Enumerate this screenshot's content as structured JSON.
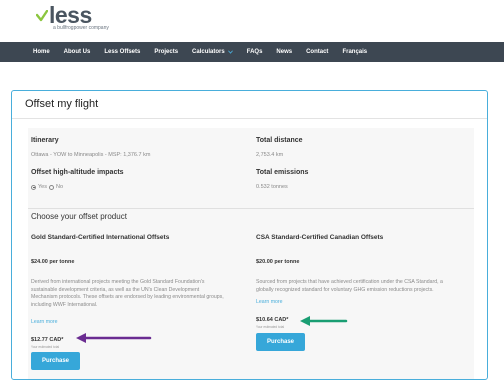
{
  "brand": {
    "name": "less",
    "tagline": "a bullfrogpower company",
    "accent": "#8cc63f"
  },
  "nav": {
    "items": [
      "Home",
      "About Us",
      "Less Offsets",
      "Projects",
      "Calculators",
      "FAQs",
      "News",
      "Contact",
      "Français"
    ]
  },
  "page": {
    "title": "Offset my flight"
  },
  "summary": {
    "itinerary_label": "Itinerary",
    "itinerary_value": "Ottawa - YOW to Minneapolis - MSP: 1,376.7 km",
    "distance_label": "Total distance",
    "distance_value": "2,753.4 km",
    "altitude_label": "Offset high-altitude impacts",
    "altitude_yes": "Yes",
    "altitude_no": "No",
    "altitude_selected": "Yes",
    "emissions_label": "Total emissions",
    "emissions_value": "0.532 tonnes"
  },
  "products": {
    "section_title": "Choose your offset product",
    "items": [
      {
        "title": "Gold Standard-Certified International Offsets",
        "price": "$24.00 per tonne",
        "description": "Derived from international projects meeting the Gold Standard Foundation's sustainable development criteria, as well as the UN's Clean Development Mechanism protocols. These offsets are endorsed by leading environmental groups, including WWF International.",
        "learn_more": "Learn more",
        "total": "$12.77 CAD*",
        "total_note": "Your estimated total",
        "button": "Purchase"
      },
      {
        "title": "CSA Standard-Certified Canadian Offsets",
        "price": "$20.00 per tonne",
        "description": "Sourced from projects that have achieved certification under the CSA Standard, a globally recognized standard for voluntary GHG emission reductions projects.",
        "learn_more": "Learn more",
        "total": "$10.64 CAD*",
        "total_note": "Your estimated total",
        "button": "Purchase"
      }
    ]
  },
  "annotations": {
    "purple_arrow_color": "#6a2c91",
    "green_arrow_color": "#1a9e73"
  }
}
